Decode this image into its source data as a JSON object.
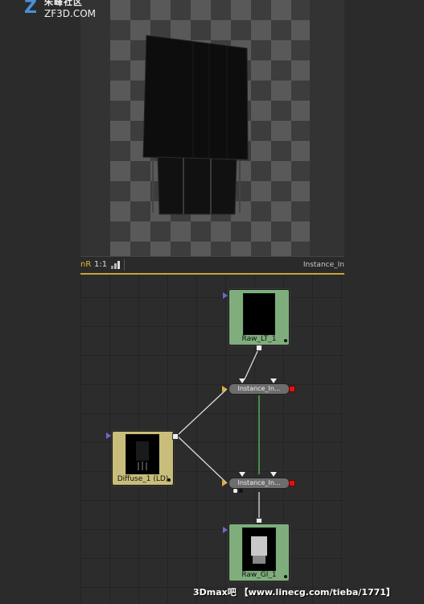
{
  "logo": {
    "mark": "Z",
    "cn_text": "朱峰社区",
    "url_text": "ZF3D.COM"
  },
  "viewer_toolbar": {
    "mode_label": "nR",
    "ratio_label": "1:1",
    "node_name": "Instance_In"
  },
  "flow": {
    "raw_lt": {
      "label": "Raw_LT_1"
    },
    "instance_top": {
      "label": "Instance_In..."
    },
    "diffuse": {
      "label": "Diffuse_1  (LD)"
    },
    "instance_bottom": {
      "label": "Instance_In..."
    },
    "raw_gi": {
      "label": "Raw_GI_1"
    }
  },
  "watermark": {
    "text": "3Dmax吧 【www.linecg.com/tieba/1771】"
  },
  "colors": {
    "loader_node": "#7fae7c",
    "saver_node": "#c9bd7b",
    "accent_yellow": "#c8a43a",
    "connection_wire": "#dcdcdc",
    "green_wire": "#5cc05c"
  }
}
